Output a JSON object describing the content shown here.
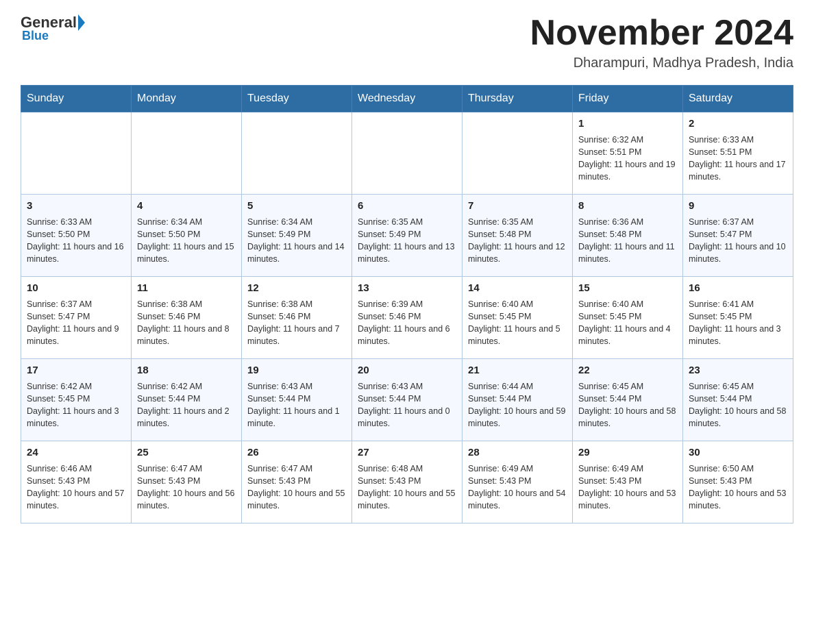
{
  "header": {
    "logo": {
      "general": "General",
      "blue": "Blue"
    },
    "title": "November 2024",
    "location": "Dharampuri, Madhya Pradesh, India"
  },
  "days_of_week": [
    "Sunday",
    "Monday",
    "Tuesday",
    "Wednesday",
    "Thursday",
    "Friday",
    "Saturday"
  ],
  "weeks": [
    [
      {
        "day": "",
        "sunrise": "",
        "sunset": "",
        "daylight": ""
      },
      {
        "day": "",
        "sunrise": "",
        "sunset": "",
        "daylight": ""
      },
      {
        "day": "",
        "sunrise": "",
        "sunset": "",
        "daylight": ""
      },
      {
        "day": "",
        "sunrise": "",
        "sunset": "",
        "daylight": ""
      },
      {
        "day": "",
        "sunrise": "",
        "sunset": "",
        "daylight": ""
      },
      {
        "day": "1",
        "sunrise": "Sunrise: 6:32 AM",
        "sunset": "Sunset: 5:51 PM",
        "daylight": "Daylight: 11 hours and 19 minutes."
      },
      {
        "day": "2",
        "sunrise": "Sunrise: 6:33 AM",
        "sunset": "Sunset: 5:51 PM",
        "daylight": "Daylight: 11 hours and 17 minutes."
      }
    ],
    [
      {
        "day": "3",
        "sunrise": "Sunrise: 6:33 AM",
        "sunset": "Sunset: 5:50 PM",
        "daylight": "Daylight: 11 hours and 16 minutes."
      },
      {
        "day": "4",
        "sunrise": "Sunrise: 6:34 AM",
        "sunset": "Sunset: 5:50 PM",
        "daylight": "Daylight: 11 hours and 15 minutes."
      },
      {
        "day": "5",
        "sunrise": "Sunrise: 6:34 AM",
        "sunset": "Sunset: 5:49 PM",
        "daylight": "Daylight: 11 hours and 14 minutes."
      },
      {
        "day": "6",
        "sunrise": "Sunrise: 6:35 AM",
        "sunset": "Sunset: 5:49 PM",
        "daylight": "Daylight: 11 hours and 13 minutes."
      },
      {
        "day": "7",
        "sunrise": "Sunrise: 6:35 AM",
        "sunset": "Sunset: 5:48 PM",
        "daylight": "Daylight: 11 hours and 12 minutes."
      },
      {
        "day": "8",
        "sunrise": "Sunrise: 6:36 AM",
        "sunset": "Sunset: 5:48 PM",
        "daylight": "Daylight: 11 hours and 11 minutes."
      },
      {
        "day": "9",
        "sunrise": "Sunrise: 6:37 AM",
        "sunset": "Sunset: 5:47 PM",
        "daylight": "Daylight: 11 hours and 10 minutes."
      }
    ],
    [
      {
        "day": "10",
        "sunrise": "Sunrise: 6:37 AM",
        "sunset": "Sunset: 5:47 PM",
        "daylight": "Daylight: 11 hours and 9 minutes."
      },
      {
        "day": "11",
        "sunrise": "Sunrise: 6:38 AM",
        "sunset": "Sunset: 5:46 PM",
        "daylight": "Daylight: 11 hours and 8 minutes."
      },
      {
        "day": "12",
        "sunrise": "Sunrise: 6:38 AM",
        "sunset": "Sunset: 5:46 PM",
        "daylight": "Daylight: 11 hours and 7 minutes."
      },
      {
        "day": "13",
        "sunrise": "Sunrise: 6:39 AM",
        "sunset": "Sunset: 5:46 PM",
        "daylight": "Daylight: 11 hours and 6 minutes."
      },
      {
        "day": "14",
        "sunrise": "Sunrise: 6:40 AM",
        "sunset": "Sunset: 5:45 PM",
        "daylight": "Daylight: 11 hours and 5 minutes."
      },
      {
        "day": "15",
        "sunrise": "Sunrise: 6:40 AM",
        "sunset": "Sunset: 5:45 PM",
        "daylight": "Daylight: 11 hours and 4 minutes."
      },
      {
        "day": "16",
        "sunrise": "Sunrise: 6:41 AM",
        "sunset": "Sunset: 5:45 PM",
        "daylight": "Daylight: 11 hours and 3 minutes."
      }
    ],
    [
      {
        "day": "17",
        "sunrise": "Sunrise: 6:42 AM",
        "sunset": "Sunset: 5:45 PM",
        "daylight": "Daylight: 11 hours and 3 minutes."
      },
      {
        "day": "18",
        "sunrise": "Sunrise: 6:42 AM",
        "sunset": "Sunset: 5:44 PM",
        "daylight": "Daylight: 11 hours and 2 minutes."
      },
      {
        "day": "19",
        "sunrise": "Sunrise: 6:43 AM",
        "sunset": "Sunset: 5:44 PM",
        "daylight": "Daylight: 11 hours and 1 minute."
      },
      {
        "day": "20",
        "sunrise": "Sunrise: 6:43 AM",
        "sunset": "Sunset: 5:44 PM",
        "daylight": "Daylight: 11 hours and 0 minutes."
      },
      {
        "day": "21",
        "sunrise": "Sunrise: 6:44 AM",
        "sunset": "Sunset: 5:44 PM",
        "daylight": "Daylight: 10 hours and 59 minutes."
      },
      {
        "day": "22",
        "sunrise": "Sunrise: 6:45 AM",
        "sunset": "Sunset: 5:44 PM",
        "daylight": "Daylight: 10 hours and 58 minutes."
      },
      {
        "day": "23",
        "sunrise": "Sunrise: 6:45 AM",
        "sunset": "Sunset: 5:44 PM",
        "daylight": "Daylight: 10 hours and 58 minutes."
      }
    ],
    [
      {
        "day": "24",
        "sunrise": "Sunrise: 6:46 AM",
        "sunset": "Sunset: 5:43 PM",
        "daylight": "Daylight: 10 hours and 57 minutes."
      },
      {
        "day": "25",
        "sunrise": "Sunrise: 6:47 AM",
        "sunset": "Sunset: 5:43 PM",
        "daylight": "Daylight: 10 hours and 56 minutes."
      },
      {
        "day": "26",
        "sunrise": "Sunrise: 6:47 AM",
        "sunset": "Sunset: 5:43 PM",
        "daylight": "Daylight: 10 hours and 55 minutes."
      },
      {
        "day": "27",
        "sunrise": "Sunrise: 6:48 AM",
        "sunset": "Sunset: 5:43 PM",
        "daylight": "Daylight: 10 hours and 55 minutes."
      },
      {
        "day": "28",
        "sunrise": "Sunrise: 6:49 AM",
        "sunset": "Sunset: 5:43 PM",
        "daylight": "Daylight: 10 hours and 54 minutes."
      },
      {
        "day": "29",
        "sunrise": "Sunrise: 6:49 AM",
        "sunset": "Sunset: 5:43 PM",
        "daylight": "Daylight: 10 hours and 53 minutes."
      },
      {
        "day": "30",
        "sunrise": "Sunrise: 6:50 AM",
        "sunset": "Sunset: 5:43 PM",
        "daylight": "Daylight: 10 hours and 53 minutes."
      }
    ]
  ]
}
